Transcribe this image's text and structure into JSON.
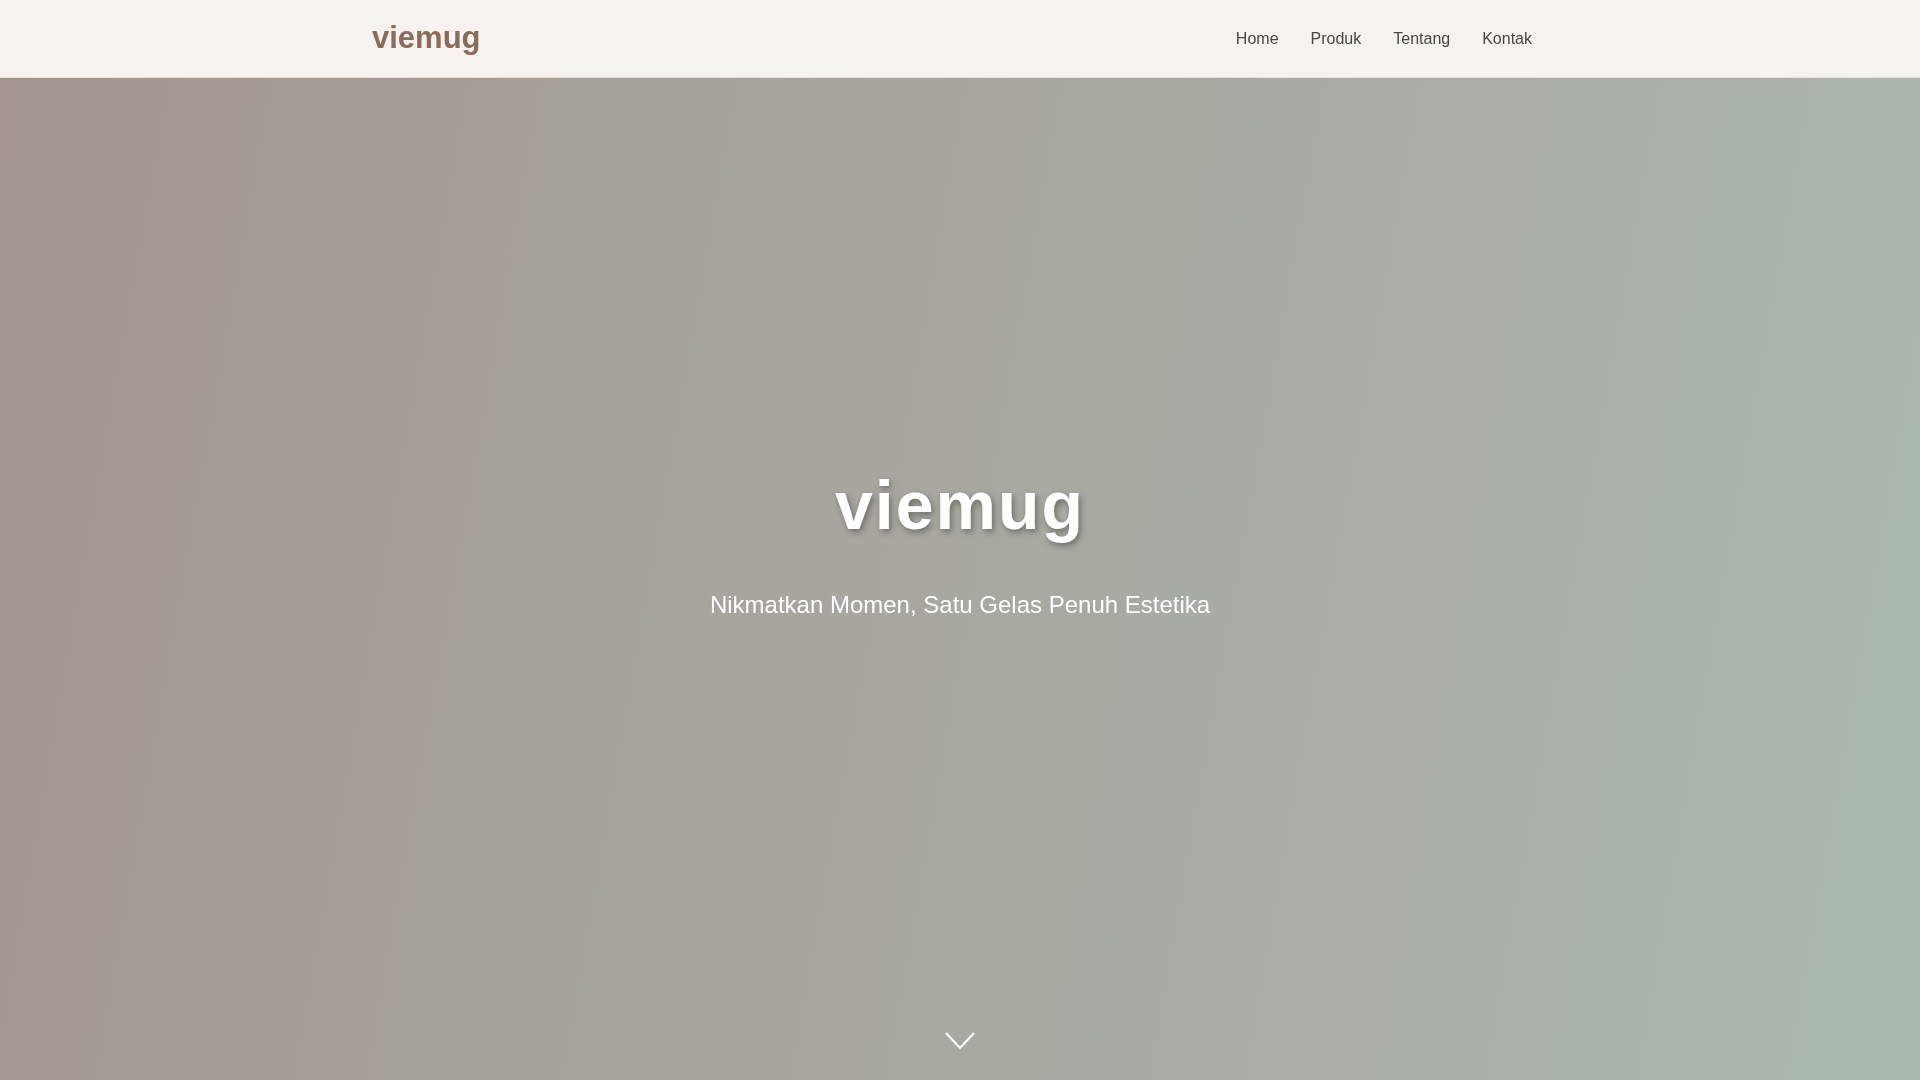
{
  "navbar": {
    "brand": "viemug",
    "links": [
      {
        "label": "Home"
      },
      {
        "label": "Produk"
      },
      {
        "label": "Tentang"
      },
      {
        "label": "Kontak"
      }
    ]
  },
  "hero": {
    "title": "viemug",
    "subtitle": "Nikmatkan Momen, Satu Gelas Penuh Estetika"
  }
}
